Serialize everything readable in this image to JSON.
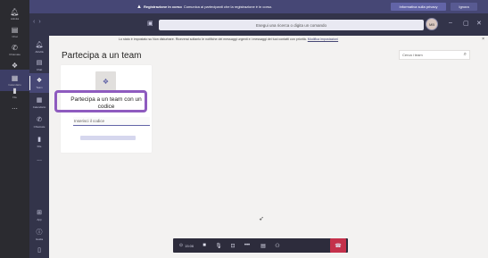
{
  "outer_rail": {
    "items": [
      {
        "icon": "bell-icon",
        "label": "Attività"
      },
      {
        "icon": "chat-icon",
        "label": "Chat"
      },
      {
        "icon": "phone-icon",
        "label": "Chiamate"
      },
      {
        "icon": "teams-icon",
        "label": "Team"
      },
      {
        "icon": "calendar-icon",
        "label": "Calendario"
      },
      {
        "icon": "file-icon",
        "label": "File"
      },
      {
        "icon": "more-icon",
        "label": "..."
      }
    ]
  },
  "banner": {
    "title": "Registrazione in corso",
    "message": "Comunica ai partecipanti che la registrazione è in corso.",
    "privacy_button": "Informativa sulla privacy",
    "ignore_button": "Ignora"
  },
  "titlebar": {
    "search_placeholder": "Esegui una ricerca o digita un comando",
    "avatar_initials": "MB"
  },
  "notice": {
    "text": "Lo stato è impostato su Non disturbare. Riceverai soltanto le notifiche dei messaggi urgenti e i messaggi dei tuoi contatti con priorità.",
    "link": "Modifica impostazioni"
  },
  "app_rail": {
    "items": [
      {
        "icon": "bell-icon",
        "label": "Attività"
      },
      {
        "icon": "chat-icon",
        "label": "Chat"
      },
      {
        "icon": "teams-icon",
        "label": "Team"
      },
      {
        "icon": "calendar-icon",
        "label": "Calendario"
      },
      {
        "icon": "phone-icon",
        "label": "Chiamate"
      },
      {
        "icon": "file-icon",
        "label": "File"
      },
      {
        "icon": "more-icon",
        "label": "..."
      }
    ],
    "bottom": [
      {
        "icon": "apps-icon",
        "label": "App"
      },
      {
        "icon": "help-icon",
        "label": "Guida"
      },
      {
        "icon": "device-icon",
        "label": ""
      }
    ]
  },
  "main": {
    "title": "Partecipa a un team",
    "team_search_placeholder": "Cerca i team",
    "card": {
      "title": "Partecipa a un team con un codice",
      "code_placeholder": "Inserisci il codice"
    }
  },
  "call_bar": {
    "timer": "15:06"
  },
  "colors": {
    "accent": "#6264a7",
    "banner": "#464775",
    "highlight": "#8e5bbf",
    "hangup": "#c4314b"
  }
}
